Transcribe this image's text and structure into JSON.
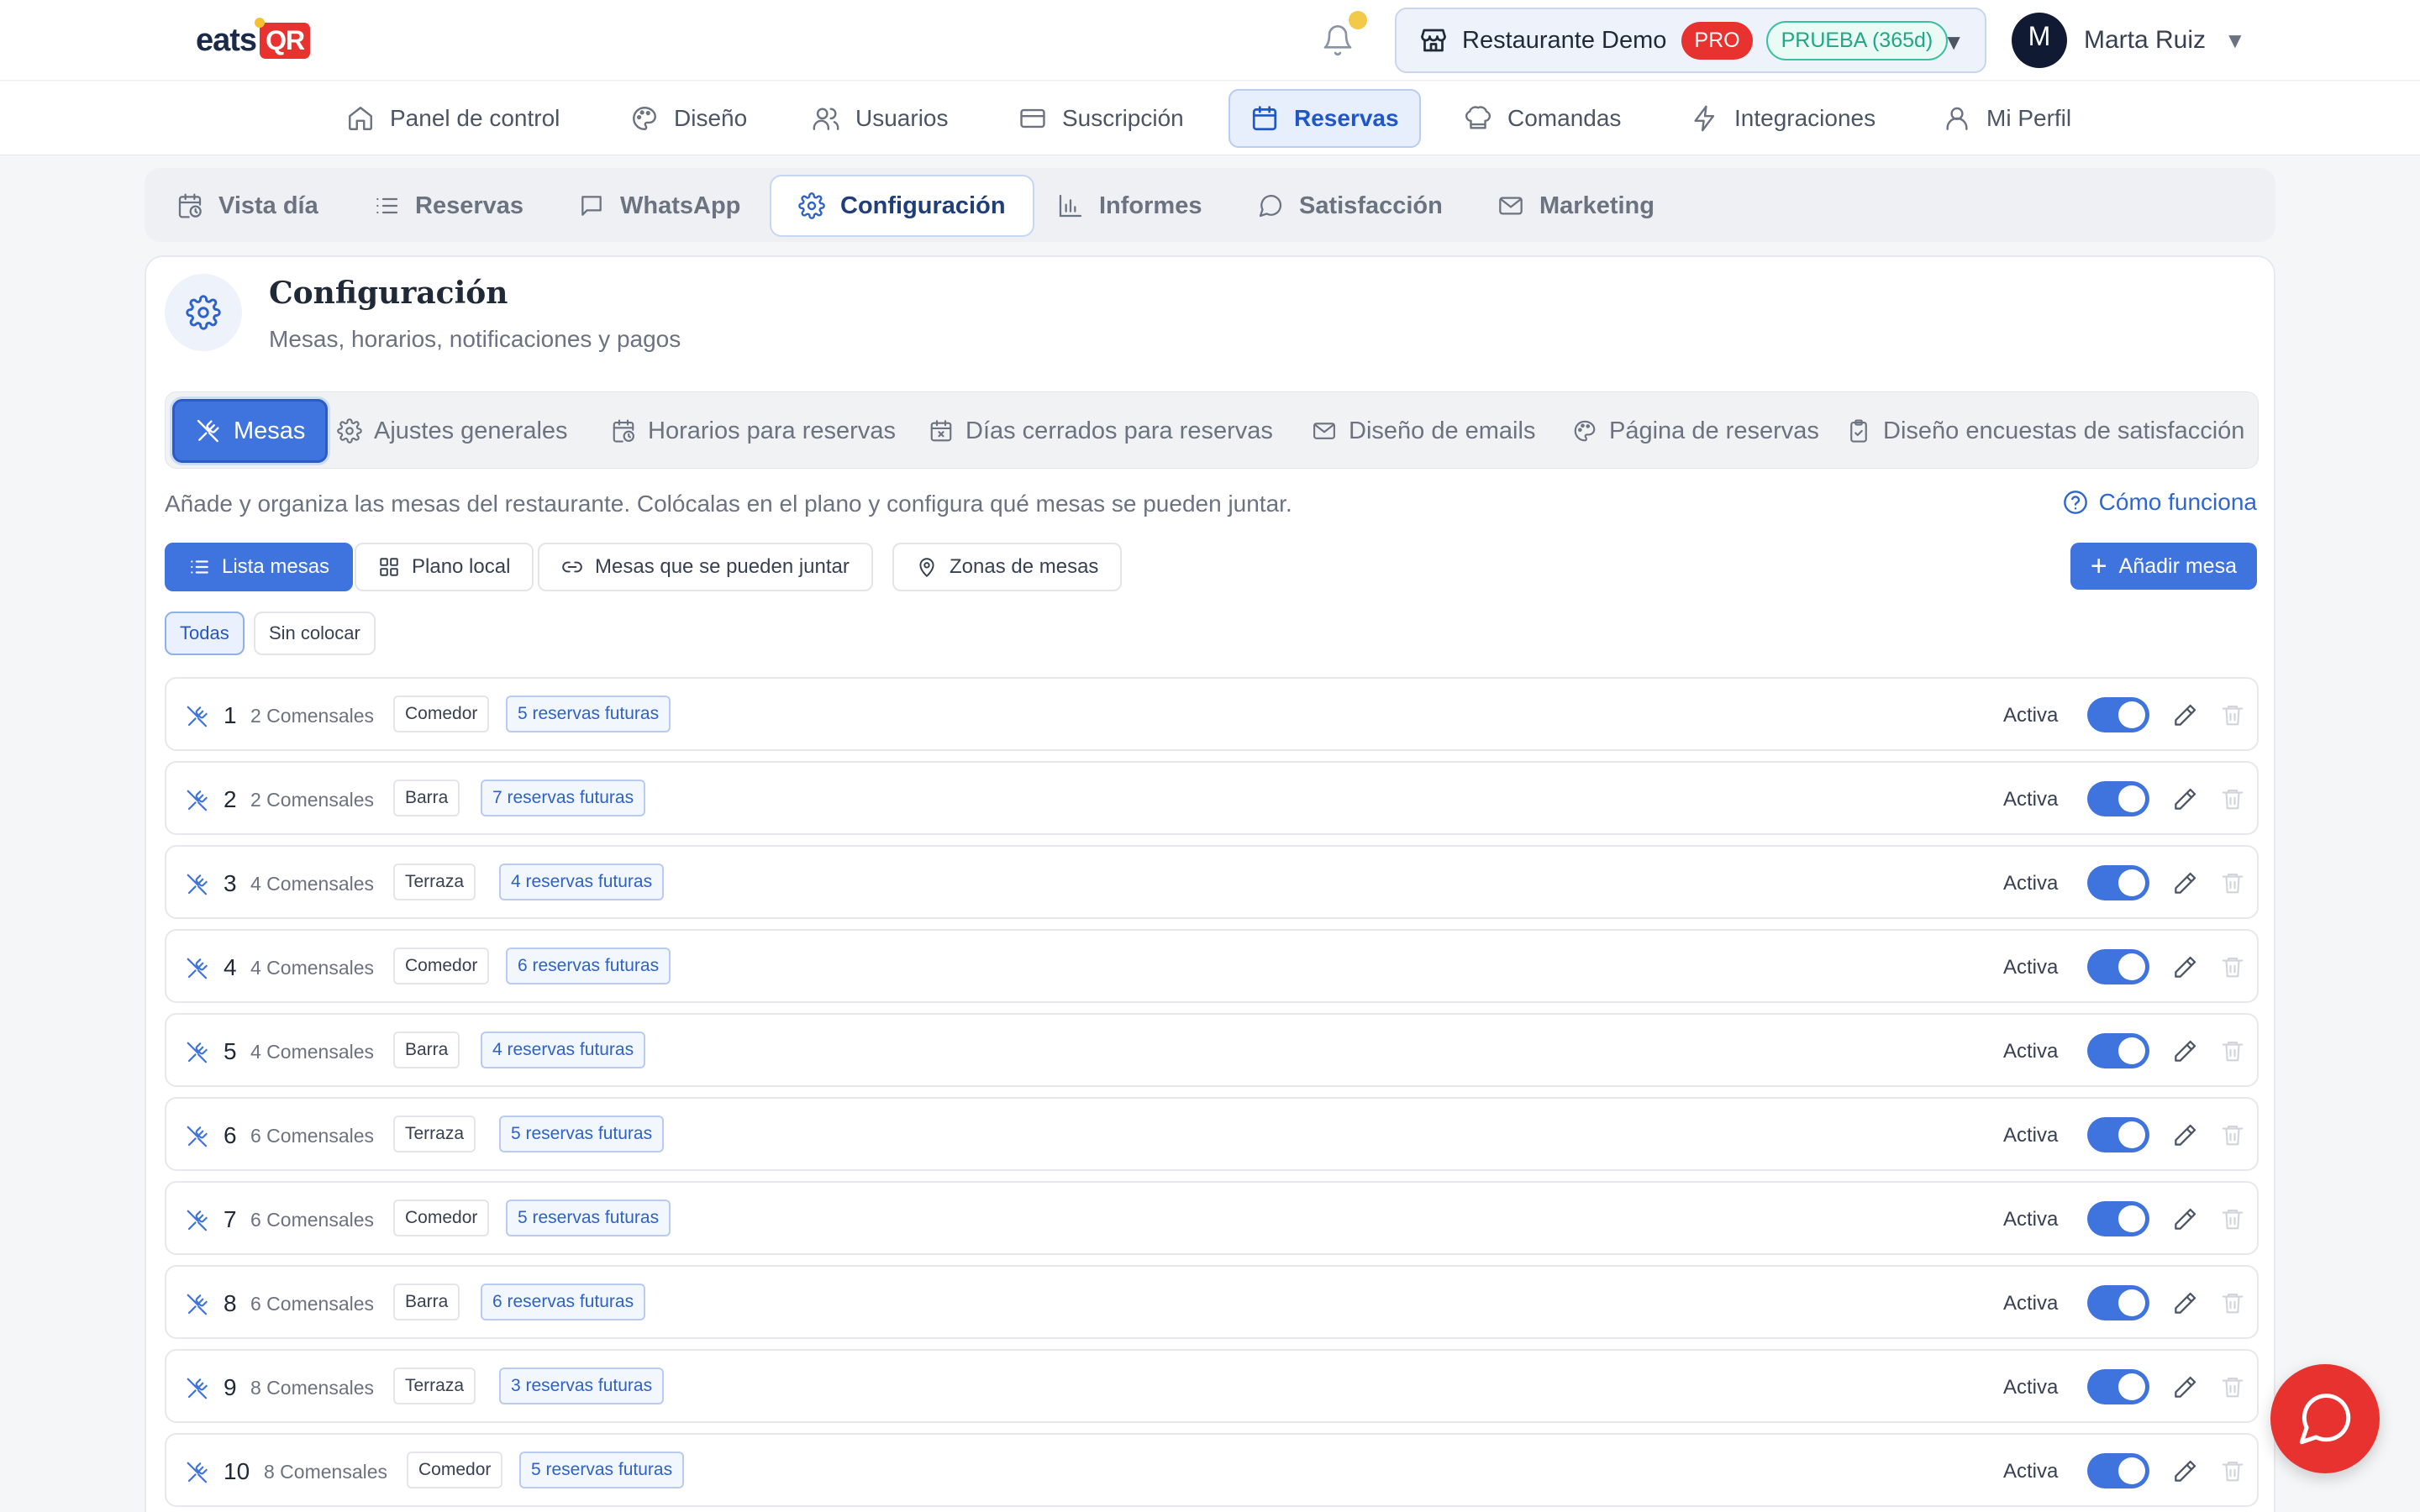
{
  "header": {
    "logo_text": "eats",
    "logo_badge": "QR",
    "restaurant_name": "Restaurante Demo",
    "plan_badge": "PRO",
    "trial_badge": "PRUEBA (365d)",
    "user_initial": "M",
    "user_name": "Marta Ruiz"
  },
  "main_nav": [
    {
      "label": "Panel de control",
      "icon": "home-icon"
    },
    {
      "label": "Diseño",
      "icon": "palette-icon"
    },
    {
      "label": "Usuarios",
      "icon": "users-icon"
    },
    {
      "label": "Suscripción",
      "icon": "credit-card-icon"
    },
    {
      "label": "Reservas",
      "icon": "calendar-icon",
      "active": true
    },
    {
      "label": "Comandas",
      "icon": "chef-hat-icon"
    },
    {
      "label": "Integraciones",
      "icon": "bolt-icon"
    },
    {
      "label": "Mi Perfil",
      "icon": "user-icon"
    }
  ],
  "sub_tabs": [
    {
      "label": "Vista día",
      "icon": "calendar-clock-icon"
    },
    {
      "label": "Reservas",
      "icon": "list-icon"
    },
    {
      "label": "WhatsApp",
      "icon": "message-icon"
    },
    {
      "label": "Configuración",
      "icon": "gear-icon",
      "active": true
    },
    {
      "label": "Informes",
      "icon": "bar-chart-icon"
    },
    {
      "label": "Satisfacción",
      "icon": "chat-bubble-icon"
    },
    {
      "label": "Marketing",
      "icon": "mail-icon"
    }
  ],
  "config": {
    "title": "Configuración",
    "subtitle": "Mesas, horarios, notificaciones y pagos",
    "pills": [
      {
        "label": "Mesas",
        "icon": "utensils-icon",
        "active": true
      },
      {
        "label": "Ajustes generales",
        "icon": "gear-icon"
      },
      {
        "label": "Horarios para reservas",
        "icon": "calendar-clock-icon"
      },
      {
        "label": "Días cerrados para reservas",
        "icon": "calendar-x-icon"
      },
      {
        "label": "Diseño de emails",
        "icon": "mail-icon"
      },
      {
        "label": "Página de reservas",
        "icon": "palette-icon"
      },
      {
        "label": "Diseño encuestas de satisfacción",
        "icon": "clipboard-icon"
      }
    ],
    "description": "Añade y organiza las mesas del restaurante. Colócalas en el plano y configura qué mesas se pueden juntar.",
    "how_it_works": "Cómo funciona",
    "views": [
      {
        "label": "Lista mesas",
        "icon": "list-icon",
        "active": true
      },
      {
        "label": "Plano local",
        "icon": "grid-icon"
      },
      {
        "label": "Mesas que se pueden juntar",
        "icon": "link-icon"
      },
      {
        "label": "Zonas de mesas",
        "icon": "map-pin-icon"
      }
    ],
    "add_button": "Añadir mesa",
    "filters": [
      {
        "label": "Todas",
        "active": true
      },
      {
        "label": "Sin colocar"
      }
    ]
  },
  "tables": [
    {
      "number": "1",
      "capacity": "2 Comensales",
      "zone": "Comedor",
      "future": "5 reservas futuras",
      "status": "Activa",
      "active": true
    },
    {
      "number": "2",
      "capacity": "2 Comensales",
      "zone": "Barra",
      "future": "7 reservas futuras",
      "status": "Activa",
      "active": true
    },
    {
      "number": "3",
      "capacity": "4 Comensales",
      "zone": "Terraza",
      "future": "4 reservas futuras",
      "status": "Activa",
      "active": true
    },
    {
      "number": "4",
      "capacity": "4 Comensales",
      "zone": "Comedor",
      "future": "6 reservas futuras",
      "status": "Activa",
      "active": true
    },
    {
      "number": "5",
      "capacity": "4 Comensales",
      "zone": "Barra",
      "future": "4 reservas futuras",
      "status": "Activa",
      "active": true
    },
    {
      "number": "6",
      "capacity": "6 Comensales",
      "zone": "Terraza",
      "future": "5 reservas futuras",
      "status": "Activa",
      "active": true
    },
    {
      "number": "7",
      "capacity": "6 Comensales",
      "zone": "Comedor",
      "future": "5 reservas futuras",
      "status": "Activa",
      "active": true
    },
    {
      "number": "8",
      "capacity": "6 Comensales",
      "zone": "Barra",
      "future": "6 reservas futuras",
      "status": "Activa",
      "active": true
    },
    {
      "number": "9",
      "capacity": "8 Comensales",
      "zone": "Terraza",
      "future": "3 reservas futuras",
      "status": "Activa",
      "active": true
    },
    {
      "number": "10",
      "capacity": "8 Comensales",
      "zone": "Comedor",
      "future": "5 reservas futuras",
      "status": "Activa",
      "active": true
    }
  ],
  "colors": {
    "accent": "#3f74de",
    "brand_red": "#e8322f",
    "trial_green": "#20a786"
  }
}
